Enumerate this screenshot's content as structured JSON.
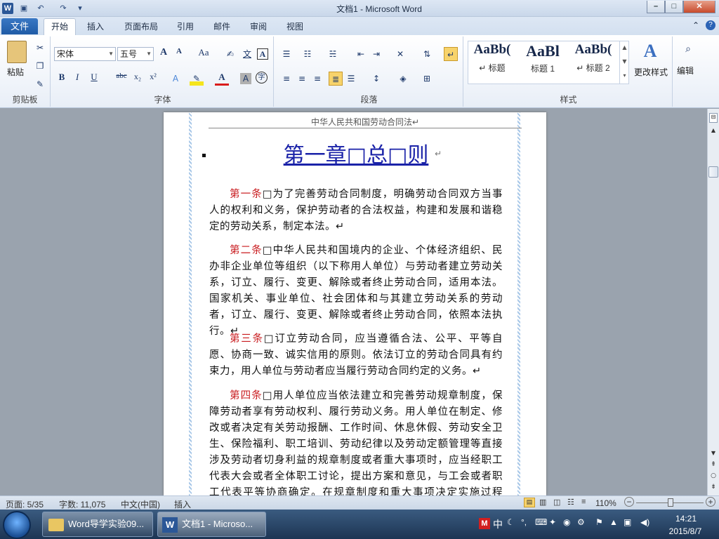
{
  "window": {
    "title": "文档1 - Microsoft Word",
    "logo": "W"
  },
  "tabs": {
    "file": "文件",
    "items": [
      "开始",
      "插入",
      "页面布局",
      "引用",
      "邮件",
      "审阅",
      "视图"
    ]
  },
  "ribbon": {
    "clipboard": {
      "label": "剪贴板",
      "paste": "粘贴"
    },
    "font": {
      "label": "字体",
      "family": "宋体",
      "size": "五号",
      "aa_grow": "A",
      "aa_shrink": "A",
      "case": "Aa",
      "wen": "文",
      "bold": "B",
      "italic": "I",
      "underline": "U",
      "strike": "abc",
      "sub": "x₂",
      "sup": "x²",
      "font_color": "A",
      "char_shading": "A",
      "enclose": "字"
    },
    "paragraph": {
      "label": "段落"
    },
    "styles": {
      "label": "样式",
      "items": [
        {
          "sample": "AaBb(",
          "name": "↵ 标题"
        },
        {
          "sample": "AaBl",
          "name": "标题 1"
        },
        {
          "sample": "AaBb(",
          "name": "↵ 标题 2"
        }
      ],
      "change": "更改样式"
    },
    "editing": {
      "label": "编辑"
    }
  },
  "document": {
    "header": "中华人民共和国劳动合同法↵",
    "chapter_title": "第一章□总□则",
    "chapter_mark": "↵",
    "paragraphs": [
      {
        "article": "第一条",
        "text": "□为了完善劳动合同制度，明确劳动合同双方当事人的权利和义务，保护劳动者的合法权益，构建和发展和谐稳定的劳动关系，制定本法。↵"
      },
      {
        "article": "第二条",
        "text": "□中华人民共和国境内的企业、个体经济组织、民办非企业单位等组织（以下称用人单位）与劳动者建立劳动关系，订立、履行、变更、解除或者终止劳动合同，适用本法。国家机关、事业单位、社会团体和与其建立劳动关系的劳动者，订立、履行、变更、解除或者终止劳动合同，依照本法执行。↵"
      },
      {
        "article": "第三条",
        "text": "□订立劳动合同，应当遵循合法、公平、平等自愿、协商一致、诚实信用的原则。依法订立的劳动合同具有约束力，用人单位与劳动者应当履行劳动合同约定的义务。↵"
      },
      {
        "article": "第四条",
        "text": "□用人单位应当依法建立和完善劳动规章制度，保障劳动者享有劳动权利、履行劳动义务。用人单位在制定、修改或者决定有关劳动报酬、工作时间、休息休假、劳动安全卫生、保险福利、职工培训、劳动纪律以及劳动定额管理等直接涉及劳动者切身利益的规章制度或者重大事项时，应当经职工代表大会或者全体职工讨论，提出方案和意见，与工会或者职工代表平等协商确定。在规章制度和重大事项决定实施过程中，"
      }
    ]
  },
  "status": {
    "page": "页面: 5/35",
    "words": "字数: 11,075",
    "lang": "中文(中国)",
    "mode": "插入",
    "zoom": "110%",
    "zoom_minus": "−",
    "zoom_plus": "+"
  },
  "taskbar": {
    "items": [
      {
        "label": "Word导学实验09..."
      },
      {
        "label": "文档1 - Microso..."
      }
    ],
    "ime": "中",
    "time": "14:21",
    "date": "2015/8/7"
  }
}
